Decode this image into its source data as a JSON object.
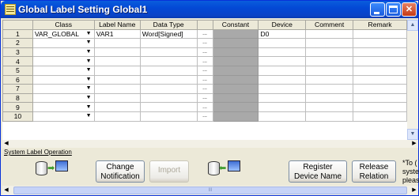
{
  "window": {
    "title": "Global Label Setting Global1",
    "controls": {
      "minimize": "_",
      "maximize": "□",
      "close": "✕"
    }
  },
  "grid": {
    "columns": [
      "Class",
      "Label Name",
      "Data Type",
      "Constant",
      "Device",
      "Comment",
      "Remark"
    ],
    "ellipsis_glyph": "...",
    "dropdown_glyph": "▼",
    "rows": [
      {
        "num": "1",
        "class": "VAR_GLOBAL",
        "label": "VAR1",
        "type": "Word[Signed]",
        "constant": "",
        "device": "D0",
        "comment": "",
        "remark": ""
      },
      {
        "num": "2",
        "class": "",
        "label": "",
        "type": "",
        "constant": "",
        "device": "",
        "comment": "",
        "remark": ""
      },
      {
        "num": "3",
        "class": "",
        "label": "",
        "type": "",
        "constant": "",
        "device": "",
        "comment": "",
        "remark": ""
      },
      {
        "num": "4",
        "class": "",
        "label": "",
        "type": "",
        "constant": "",
        "device": "",
        "comment": "",
        "remark": ""
      },
      {
        "num": "5",
        "class": "",
        "label": "",
        "type": "",
        "constant": "",
        "device": "",
        "comment": "",
        "remark": ""
      },
      {
        "num": "6",
        "class": "",
        "label": "",
        "type": "",
        "constant": "",
        "device": "",
        "comment": "",
        "remark": ""
      },
      {
        "num": "7",
        "class": "",
        "label": "",
        "type": "",
        "constant": "",
        "device": "",
        "comment": "",
        "remark": ""
      },
      {
        "num": "8",
        "class": "",
        "label": "",
        "type": "",
        "constant": "",
        "device": "",
        "comment": "",
        "remark": ""
      },
      {
        "num": "9",
        "class": "",
        "label": "",
        "type": "",
        "constant": "",
        "device": "",
        "comment": "",
        "remark": ""
      },
      {
        "num": "10",
        "class": "",
        "label": "",
        "type": "",
        "constant": "",
        "device": "",
        "comment": "",
        "remark": ""
      }
    ]
  },
  "system_label": {
    "heading": "System Label Operation",
    "buttons": {
      "change_notification": "Change\nNotification",
      "import": "Import",
      "register_device_name": "Register\nDevice Name",
      "release_relation": "Release\nRelation"
    },
    "note_lines": [
      "*To (",
      "syste",
      "pleas"
    ]
  },
  "scroll": {
    "up": "▲",
    "down": "▼",
    "left": "◀",
    "right": "▶",
    "grip": "III"
  }
}
